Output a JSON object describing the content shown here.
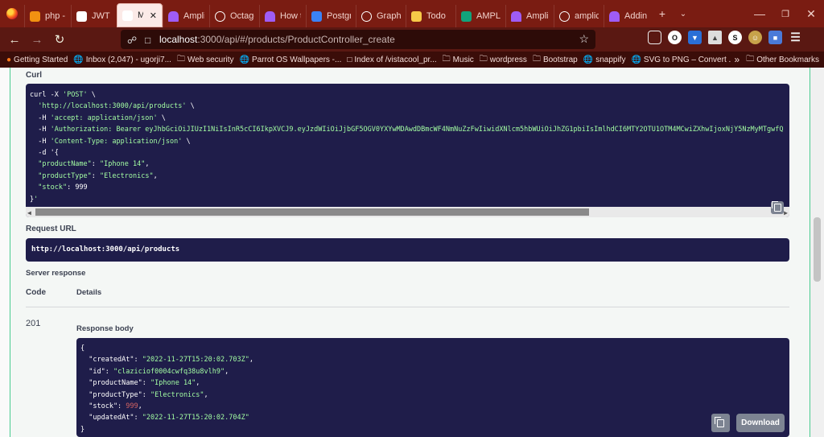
{
  "browser": {
    "tabs": [
      {
        "label": "php - F",
        "favicon_color": "#f29111",
        "favicon": "php-icon",
        "active": false
      },
      {
        "label": "JWT Au",
        "favicon_color": "#ffffff",
        "favicon": "jwt-icon",
        "active": false
      },
      {
        "label": "My serv",
        "favicon_color": "#ffffff",
        "favicon": "",
        "active": true
      },
      {
        "label": "Amplic",
        "favicon_color": "#9f5cf6",
        "favicon": "amplication-icon",
        "active": false
      },
      {
        "label": "Octago",
        "favicon_color": "#ffffff",
        "favicon": "github-icon",
        "active": false
      },
      {
        "label": "How to",
        "favicon_color": "#9f5cf6",
        "favicon": "amplication-icon",
        "active": false
      },
      {
        "label": "Postgre",
        "favicon_color": "#3b82f6",
        "favicon": "postgres-icon",
        "active": false
      },
      {
        "label": "GraphQ",
        "favicon_color": "#ffffff",
        "favicon": "graphql-icon",
        "active": false
      },
      {
        "label": "Todo",
        "favicon_color": "#f7c948",
        "favicon": "vite-icon",
        "active": false
      },
      {
        "label": "AMPLIF",
        "favicon_color": "#12a37b",
        "favicon": "t-icon",
        "active": false
      },
      {
        "label": "Amplic",
        "favicon_color": "#9f5cf6",
        "favicon": "amplication-icon",
        "active": false
      },
      {
        "label": "amplic",
        "favicon_color": "#ffffff",
        "favicon": "github-icon",
        "active": false
      },
      {
        "label": "Adding",
        "favicon_color": "#9f5cf6",
        "favicon": "amplication-icon",
        "active": false
      }
    ],
    "url_host": "localhost",
    "url_path": ":3000/api/#/products/ProductController_create",
    "bookmarks": [
      {
        "label": "Getting Started",
        "icon": "firefox-icon"
      },
      {
        "label": "Inbox (2,047) - ugorji7...",
        "icon": "globe-icon"
      },
      {
        "label": "Web security",
        "icon": "folder-icon"
      },
      {
        "label": "Parrot OS Wallpapers -...",
        "icon": "globe-icon"
      },
      {
        "label": "Index of /vistacool_pr...",
        "icon": "page-icon"
      },
      {
        "label": "Music",
        "icon": "folder-icon"
      },
      {
        "label": "wordpress",
        "icon": "folder-icon"
      },
      {
        "label": "Bootstrap",
        "icon": "folder-icon"
      },
      {
        "label": "snappify",
        "icon": "globe-icon"
      },
      {
        "label": "SVG to PNG – Convert ...",
        "icon": "globe-icon"
      }
    ],
    "bookmarks_more": "»",
    "other_bookmarks": "Other Bookmarks"
  },
  "swagger": {
    "curl_label": "Curl",
    "curl_lines": [
      "curl -X 'POST' \\",
      "  'http://localhost:3000/api/products' \\",
      "  -H 'accept: application/json' \\",
      "  -H 'Authorization: Bearer eyJhbGciOiJIUzI1NiIsInR5cCI6IkpXVCJ9.eyJzdWIiOiJjbGF5OGV0YXYwMDAwdDBmcWF4NmNuZzFwIiwidXNlcm5hbWUiOiJhZG1pbiIsImlhdCI6MTY2OTU1OTM4MCwiZXhwIjoxNjY5NzMyMTgwfQ",
      "  -H 'Content-Type: application/json' \\",
      "  -d '{",
      "  \"productName\": \"Iphone 14\",",
      "  \"productType\": \"Electronics\",",
      "  \"stock\": 999",
      "}'"
    ],
    "request_url_label": "Request URL",
    "request_url": "http://localhost:3000/api/products",
    "server_response_label": "Server response",
    "code_header": "Code",
    "details_header": "Details",
    "status_code": "201",
    "response_body_label": "Response body",
    "response_lines": [
      {
        "pre": "{",
        "str": "",
        "num": "",
        "post": ""
      },
      {
        "pre": "  \"createdAt\": ",
        "str": "\"2022-11-27T15:20:02.703Z\"",
        "num": "",
        "post": ","
      },
      {
        "pre": "  \"id\": ",
        "str": "\"claziciof0004cwfq38u8vlh9\"",
        "num": "",
        "post": ","
      },
      {
        "pre": "  \"productName\": ",
        "str": "\"Iphone 14\"",
        "num": "",
        "post": ","
      },
      {
        "pre": "  \"productType\": ",
        "str": "\"Electronics\"",
        "num": "",
        "post": ","
      },
      {
        "pre": "  \"stock\": ",
        "str": "",
        "num": "999",
        "post": ","
      },
      {
        "pre": "  \"updatedAt\": ",
        "str": "\"2022-11-27T15:20:02.704Z\"",
        "num": "",
        "post": ""
      },
      {
        "pre": "}",
        "str": "",
        "num": "",
        "post": ""
      }
    ],
    "download_label": "Download"
  }
}
